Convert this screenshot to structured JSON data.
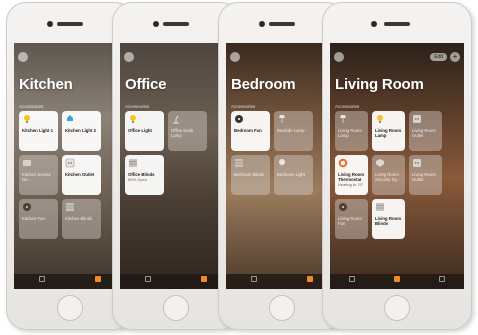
{
  "phones": [
    {
      "room": "Kitchen",
      "time": "",
      "battery": "",
      "section": "Accessories",
      "tiles": [
        {
          "name": "Kitchen Light 1",
          "state": "on",
          "icon": "bulb-icon"
        },
        {
          "name": "Kitchen Light 2",
          "state": "on",
          "icon": "cloud-icon"
        },
        {
          "name": "Kitchen Smoke De...",
          "state": "off",
          "icon": "sensor-icon"
        },
        {
          "name": "Kitchen Outlet",
          "state": "on",
          "icon": "outlet-icon"
        },
        {
          "name": "Kitchen Fan",
          "state": "off",
          "icon": "fan-icon"
        },
        {
          "name": "Kitchen Blinds",
          "state": "off",
          "icon": "blinds-icon"
        }
      ]
    },
    {
      "room": "Office",
      "time": "",
      "battery": "",
      "section": "Accessories",
      "tiles": [
        {
          "name": "Office Light",
          "state": "on",
          "icon": "bulb-icon"
        },
        {
          "name": "Office Desk Lamp",
          "state": "off",
          "icon": "desk-lamp-icon"
        },
        {
          "name": "Office Blinds",
          "status": "50% Open",
          "state": "on",
          "icon": "blinds-icon"
        }
      ]
    },
    {
      "room": "Bedroom",
      "time": "",
      "battery": "",
      "section": "Accessories",
      "tiles": [
        {
          "name": "Bedroom Fan",
          "state": "on",
          "icon": "fan-icon"
        },
        {
          "name": "Bedside Lamp",
          "state": "off",
          "icon": "lamp-icon"
        },
        {
          "name": "Bedroom Blinds",
          "state": "off",
          "icon": "blinds-icon"
        },
        {
          "name": "Bedroom Light",
          "state": "off",
          "icon": "bulb-icon"
        }
      ]
    },
    {
      "room": "Living Room",
      "time": "",
      "battery": "",
      "section": "Accessories",
      "edit_label": "Edit",
      "add_label": "+",
      "tiles": [
        {
          "name": "Living Room Lamp",
          "state": "off",
          "icon": "lamp-icon"
        },
        {
          "name": "Living Room Lamp",
          "state": "on",
          "icon": "bulb-icon"
        },
        {
          "name": "Living Room Outlet",
          "state": "off",
          "icon": "outlet-icon"
        },
        {
          "name": "Living Room Thermostat",
          "status": "Heating to 70°",
          "state": "on",
          "icon": "thermostat-icon"
        },
        {
          "name": "Living Room Security Sy...",
          "state": "off",
          "icon": "security-icon"
        },
        {
          "name": "Living Room Outlet",
          "state": "off",
          "icon": "outlet-icon"
        },
        {
          "name": "Living Room Fan",
          "state": "off",
          "icon": "fan-icon"
        },
        {
          "name": "Living Room Blinds",
          "state": "on",
          "icon": "blinds-icon"
        }
      ]
    }
  ],
  "colors": {
    "accent": "#f18a2d",
    "tile_on": "#ffffff",
    "alert": "#d6382b"
  }
}
